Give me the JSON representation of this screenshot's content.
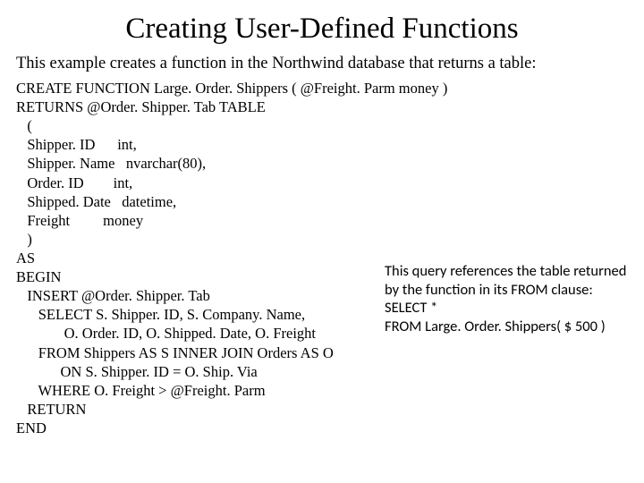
{
  "title": "Creating User-Defined Functions",
  "intro": "This example creates a function in the Northwind database that returns a table:",
  "code": {
    "l01": "CREATE FUNCTION Large. Order. Shippers ( @Freight. Parm money )",
    "l02": "RETURNS @Order. Shipper. Tab TABLE",
    "l03": "   (",
    "l04": "   Shipper. ID      int,",
    "l05": "   Shipper. Name   nvarchar(80),",
    "l06": "   Order. ID        int,",
    "l07": "   Shipped. Date   datetime,",
    "l08": "   Freight         money",
    "l09": "   )",
    "l10": "AS",
    "l11": "BEGIN",
    "l12": "   INSERT @Order. Shipper. Tab",
    "l13": "      SELECT S. Shipper. ID, S. Company. Name,",
    "l14": "             O. Order. ID, O. Shipped. Date, O. Freight",
    "l15": "      FROM Shippers AS S INNER JOIN Orders AS O",
    "l16": "            ON S. Shipper. ID = O. Ship. Via",
    "l17": "      WHERE O. Freight > @Freight. Parm",
    "l18": "   RETURN",
    "l19": "END"
  },
  "side": {
    "p1": "This query references the table returned by the function in its FROM clause:",
    "p2": "SELECT *",
    "p3": "FROM Large. Order. Shippers( $ 500 )"
  }
}
